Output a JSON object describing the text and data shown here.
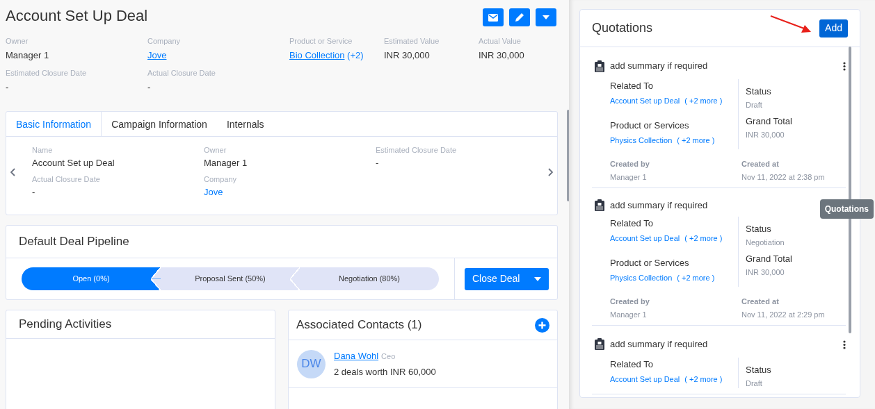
{
  "title": "Account Set Up Deal",
  "header_actions": [
    {
      "kind": "email"
    },
    {
      "kind": "edit"
    },
    {
      "kind": "dropdown"
    }
  ],
  "summary_fields": [
    {
      "label": "Owner",
      "value": "Manager 1"
    },
    {
      "label": "Company",
      "link": "Jove"
    },
    {
      "label": "Product or Service",
      "link": "Bio Collection",
      "extra": "(+2)"
    },
    {
      "label": "Estimated Value",
      "value": "INR 30,000"
    },
    {
      "label": "Actual Value",
      "value": "INR 30,000"
    },
    {
      "label": "Estimated Closure Date",
      "value": "-"
    },
    {
      "label": "Actual Closure Date",
      "value": "-"
    }
  ],
  "tabs": [
    {
      "label": "Basic Information",
      "selected": true
    },
    {
      "label": "Campaign Information",
      "selected": false
    },
    {
      "label": "Internals",
      "selected": false
    }
  ],
  "basic_info": [
    {
      "label": "Name",
      "value": "Account Set up Deal"
    },
    {
      "label": "Owner",
      "value": "Manager 1"
    },
    {
      "label": "Estimated Closure Date",
      "value": "-"
    },
    {
      "label": "Actual Closure Date",
      "value": "-"
    },
    {
      "label": "Company",
      "link": "Jove"
    }
  ],
  "pipeline": {
    "title": "Default Deal Pipeline",
    "stages": [
      {
        "label": "Open (0%)",
        "selected": true
      },
      {
        "label": "Proposal Sent (50%)",
        "selected": false
      },
      {
        "label": "Negotiation (80%)",
        "selected": false
      }
    ],
    "close_button": "Close Deal"
  },
  "pending_activities": {
    "title": "Pending Activities"
  },
  "associated_contacts": {
    "title": "Associated Contacts (1)",
    "contacts": [
      {
        "initials": "DW",
        "name": "Dana Wohl",
        "role": "Ceo",
        "summary": "2 deals worth INR 60,000"
      }
    ]
  },
  "quotations": {
    "title": "Quotations",
    "add_button": "Add",
    "tooltip": "Quotations",
    "items": [
      {
        "summary": "add summary if required",
        "menu": true,
        "related_label": "Related To",
        "related_link": "Account Set up Deal",
        "related_more": "( +2 more )",
        "product_label": "Product or Services",
        "product_link": "Physics Collection",
        "product_more": "( +2 more )",
        "status_label": "Status",
        "status": "Draft",
        "total_label": "Grand Total",
        "total": "INR 30,000",
        "created_by_label": "Created by",
        "created_by": "Manager 1",
        "created_at_label": "Created at",
        "created_at": "Nov 11, 2022 at 2:38 pm"
      },
      {
        "summary": "add summary if required",
        "menu": false,
        "related_label": "Related To",
        "related_link": "Account Set up Deal",
        "related_more": "( +2 more )",
        "product_label": "Product or Services",
        "product_link": "Physics Collection",
        "product_more": "( +2 more )",
        "status_label": "Status",
        "status": "Negotiation",
        "total_label": "Grand Total",
        "total": "INR 30,000",
        "created_by_label": "Created by",
        "created_by": "Manager 1",
        "created_at_label": "Created at",
        "created_at": "Nov 11, 2022 at 2:29 pm"
      },
      {
        "summary": "add summary if required",
        "menu": true,
        "related_label": "Related To",
        "related_link": "Account Set up Deal",
        "related_more": "( +2 more )",
        "status_label": "Status",
        "status": "Draft"
      }
    ]
  }
}
